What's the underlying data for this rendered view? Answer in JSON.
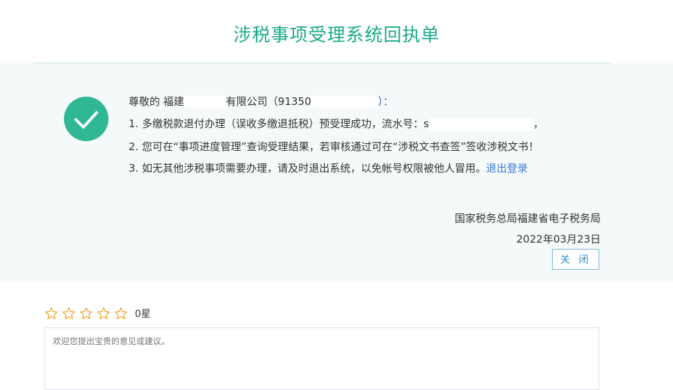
{
  "header": {
    "title": "涉税事项受理系统回执单"
  },
  "receipt": {
    "greeting_prefix": "尊敬的 福建",
    "greeting_company": "有限公司（91350",
    "greeting_suffix": "）：",
    "line1_prefix": "1. 多缴税款退付办理（误收多缴退抵税）预受理成功，流水号：s",
    "line1_suffix": "，",
    "line2": "2. 您可在“事项进度管理”查询受理结果，若审核通过可在“涉税文书查签”签收涉税文书！",
    "line3": "3. 如无其他涉税事项需要办理，请及时退出系统，以免帐号权限被他人冒用。",
    "logout_link": "退出登录",
    "issuer": "国家税务总局福建省电子税务局",
    "date": "2022年03月23日",
    "close_label": "关 闭"
  },
  "rating": {
    "value": 0,
    "max": 5,
    "label": "0星",
    "star_color": "#f0a836"
  },
  "feedback": {
    "placeholder": "欢迎您提出宝贵的意见或建议。",
    "value": ""
  },
  "colors": {
    "accent": "#1bab8a",
    "check_bg": "#30b894",
    "link": "#3a7bd5"
  }
}
